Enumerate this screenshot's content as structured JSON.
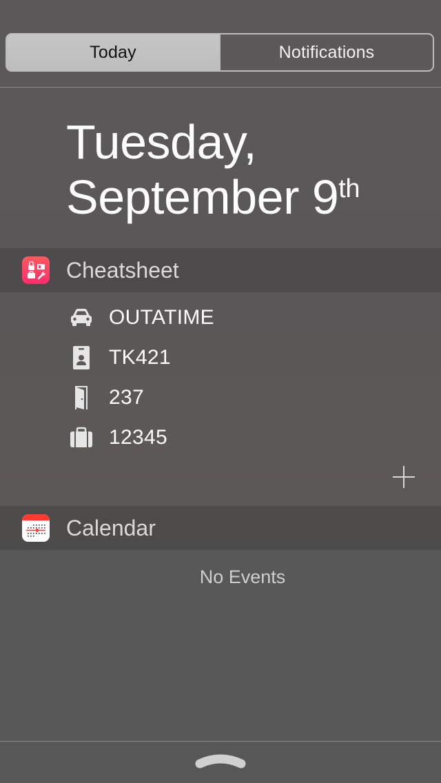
{
  "segmented": {
    "today_label": "Today",
    "notifications_label": "Notifications"
  },
  "date": {
    "line1": "Tuesday,",
    "line2_main": "September 9",
    "line2_suffix": "th"
  },
  "cheatsheet": {
    "title": "Cheatsheet",
    "accent_color": "#ff3b6b",
    "items": [
      {
        "icon": "car-icon",
        "text": "OUTATIME"
      },
      {
        "icon": "id-badge-icon",
        "text": "TK421"
      },
      {
        "icon": "door-icon",
        "text": "237"
      },
      {
        "icon": "suitcase-icon",
        "text": "12345"
      }
    ]
  },
  "calendar": {
    "title": "Calendar",
    "empty_text": "No Events",
    "accent_color": "#ff3b30"
  },
  "icons": {
    "add": "plus-icon",
    "grabber": "grabber-handle-icon"
  }
}
